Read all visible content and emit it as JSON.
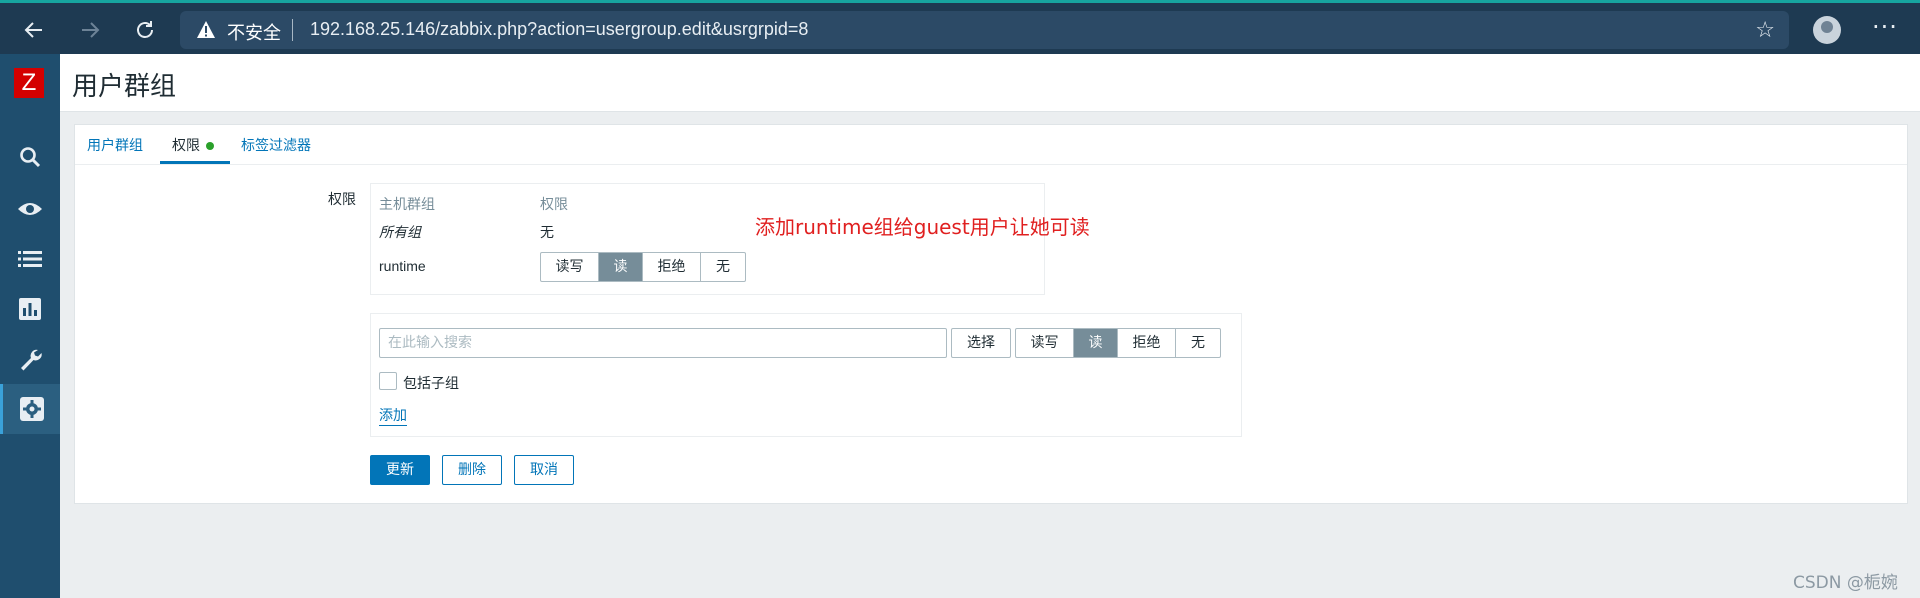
{
  "browser": {
    "insecure_label": "不安全",
    "url": "192.168.25.146/zabbix.php?action=usergroup.edit&usrgrpid=8",
    "back_icon": "arrow-left-icon",
    "forward_icon": "arrow-right-icon",
    "refresh_icon": "refresh-icon"
  },
  "app": {
    "logo": "Z",
    "page_title": "用户群组"
  },
  "sidebar": {
    "items": [
      {
        "icon": "search-icon"
      },
      {
        "icon": "eye-icon"
      },
      {
        "icon": "list-icon"
      },
      {
        "icon": "chart-icon"
      },
      {
        "icon": "wrench-icon"
      },
      {
        "icon": "gear-icon",
        "active": true
      }
    ]
  },
  "tabs": [
    {
      "label": "用户群组"
    },
    {
      "label": "权限",
      "active": true
    },
    {
      "label": "标签过滤器"
    }
  ],
  "permissions": {
    "label": "权限",
    "headers": [
      "主机群组",
      "权限"
    ],
    "rows": [
      {
        "group": "所有组",
        "permission": "无"
      },
      {
        "group": "runtime",
        "options": [
          "读写",
          "读",
          "拒绝",
          "无"
        ],
        "selected": "读"
      }
    ],
    "note": "添加runtime组给guest用户让她可读"
  },
  "add_form": {
    "search_placeholder": "在此输入搜索",
    "select_button": "选择",
    "options": [
      "读写",
      "读",
      "拒绝",
      "无"
    ],
    "selected": "读",
    "include_subgroups": "包括子组",
    "add_link": "添加"
  },
  "actions": {
    "update": "更新",
    "delete": "删除",
    "cancel": "取消"
  },
  "watermark": "CSDN @栀婉",
  "colors": {
    "accent": "#0275b8",
    "sidebar": "#1f4e6e",
    "note": "#e02020",
    "selected_segment": "#768d99"
  }
}
